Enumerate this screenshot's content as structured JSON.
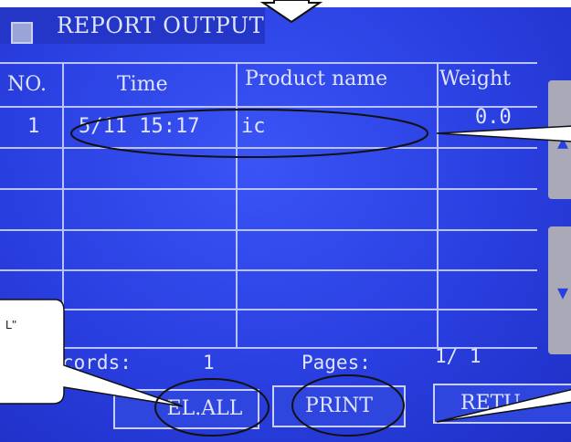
{
  "title": "REPORT OUTPUT",
  "table": {
    "headers": [
      "NO.",
      "Time",
      "Product name",
      "Weight"
    ],
    "rows": [
      [
        "1",
        "5/11 15:17",
        "ic",
        "0.0"
      ],
      [
        "",
        "",
        "",
        ""
      ],
      [
        "",
        "",
        "",
        ""
      ],
      [
        "",
        "",
        "",
        ""
      ],
      [
        "",
        "",
        "",
        ""
      ],
      [
        "",
        "",
        "",
        ""
      ]
    ]
  },
  "footer": {
    "records_label": "cords:",
    "records_value": "1",
    "pages_label": "Pages:",
    "pages_value": "1/ 1"
  },
  "buttons": {
    "del_all": "EL.ALL",
    "print": "PRINT",
    "return": "RETU"
  },
  "side_buttons": {
    "up_icon": "up-arrow-icon",
    "down_icon": "down-arrow-icon"
  },
  "callouts": {
    "left_text": "L\""
  },
  "colors": {
    "screen_blue": "#2a3fe0",
    "grid_line": "#b9c3ff",
    "text": "#dfe4ff"
  }
}
